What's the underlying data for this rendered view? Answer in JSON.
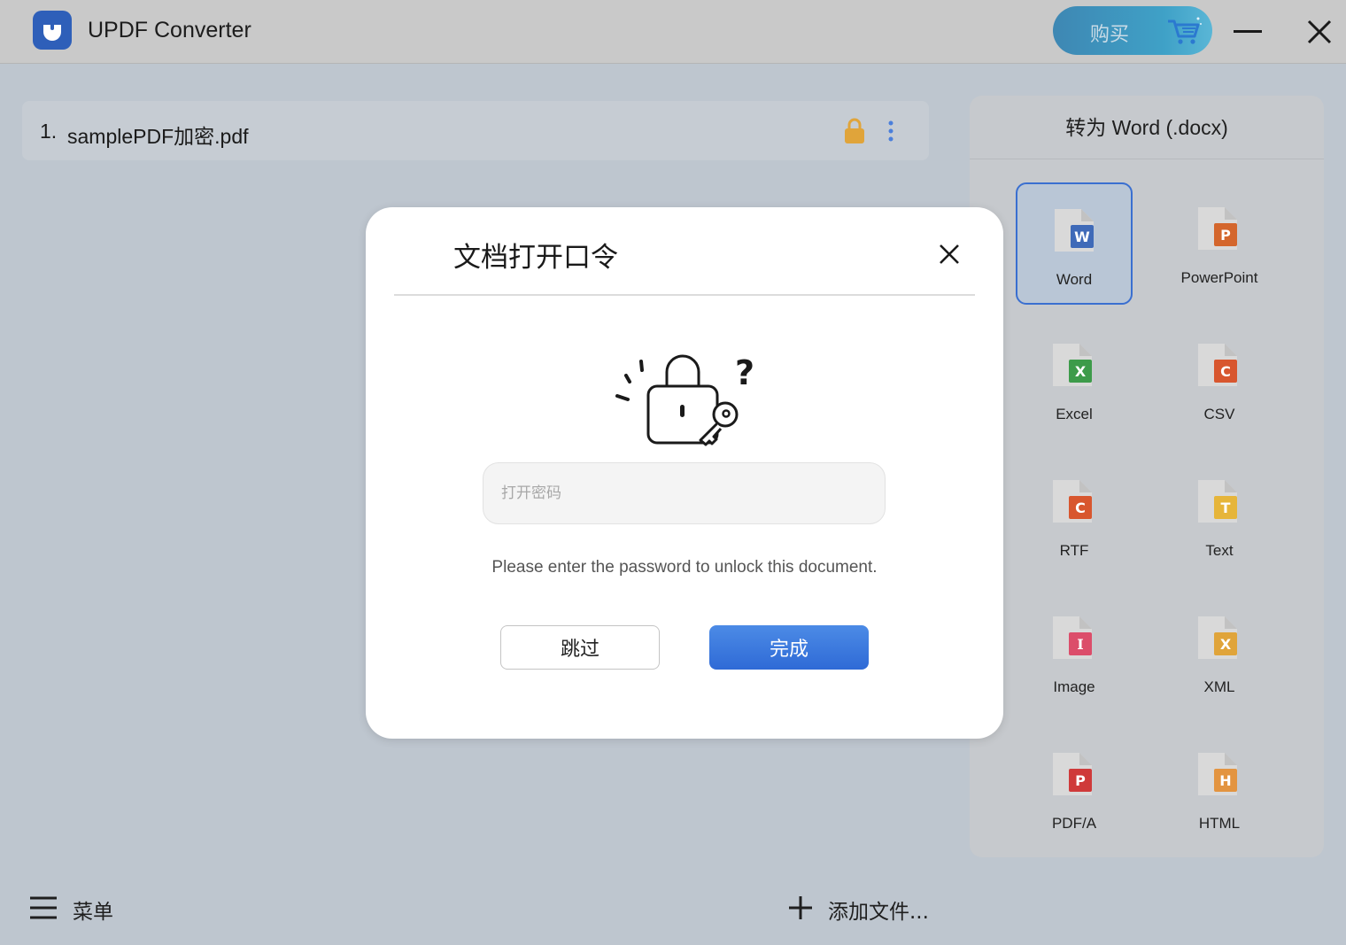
{
  "window": {
    "title": "UPDF Converter",
    "buy_label": "购买",
    "icons": [
      "updf-logo-icon",
      "cart-icon",
      "minimize-icon",
      "close-icon"
    ]
  },
  "file_list": {
    "items": [
      {
        "index": "1.",
        "name": "samplePDF加密.pdf",
        "locked": true
      }
    ]
  },
  "format_panel": {
    "title": "转为 Word (.docx)",
    "selected": "Word",
    "formats": [
      {
        "label": "Word",
        "letter": "W",
        "color": "#3f6ab8"
      },
      {
        "label": "PowerPoint",
        "letter": "P",
        "color": "#d4662c"
      },
      {
        "label": "Excel",
        "letter": "X",
        "color": "#3d9b4a"
      },
      {
        "label": "CSV",
        "letter": "C",
        "color": "#d8562e"
      },
      {
        "label": "RTF",
        "letter": "C",
        "color": "#d8562e"
      },
      {
        "label": "Text",
        "letter": "T",
        "color": "#e6b53a"
      },
      {
        "label": "Image",
        "letter": "I",
        "color": "#dc4d6a"
      },
      {
        "label": "XML",
        "letter": "X",
        "color": "#e0a43a"
      },
      {
        "label": "PDF/A",
        "letter": "P",
        "color": "#cf3a3a"
      },
      {
        "label": "HTML",
        "letter": "H",
        "color": "#e39440"
      }
    ]
  },
  "bottom_bar": {
    "menu_label": "菜单",
    "add_file_label": "添加文件..."
  },
  "dialog": {
    "title": "文档打开口令",
    "password_placeholder": "打开密码",
    "password_value": "",
    "hint": "Please enter the password to unlock this document.",
    "skip_label": "跳过",
    "done_label": "完成"
  },
  "colors": {
    "accent": "#2f6ad6",
    "buy_gradient_start": "#3e87b3",
    "buy_gradient_end": "#5ab6d6",
    "lock_color": "#e0a43a"
  }
}
